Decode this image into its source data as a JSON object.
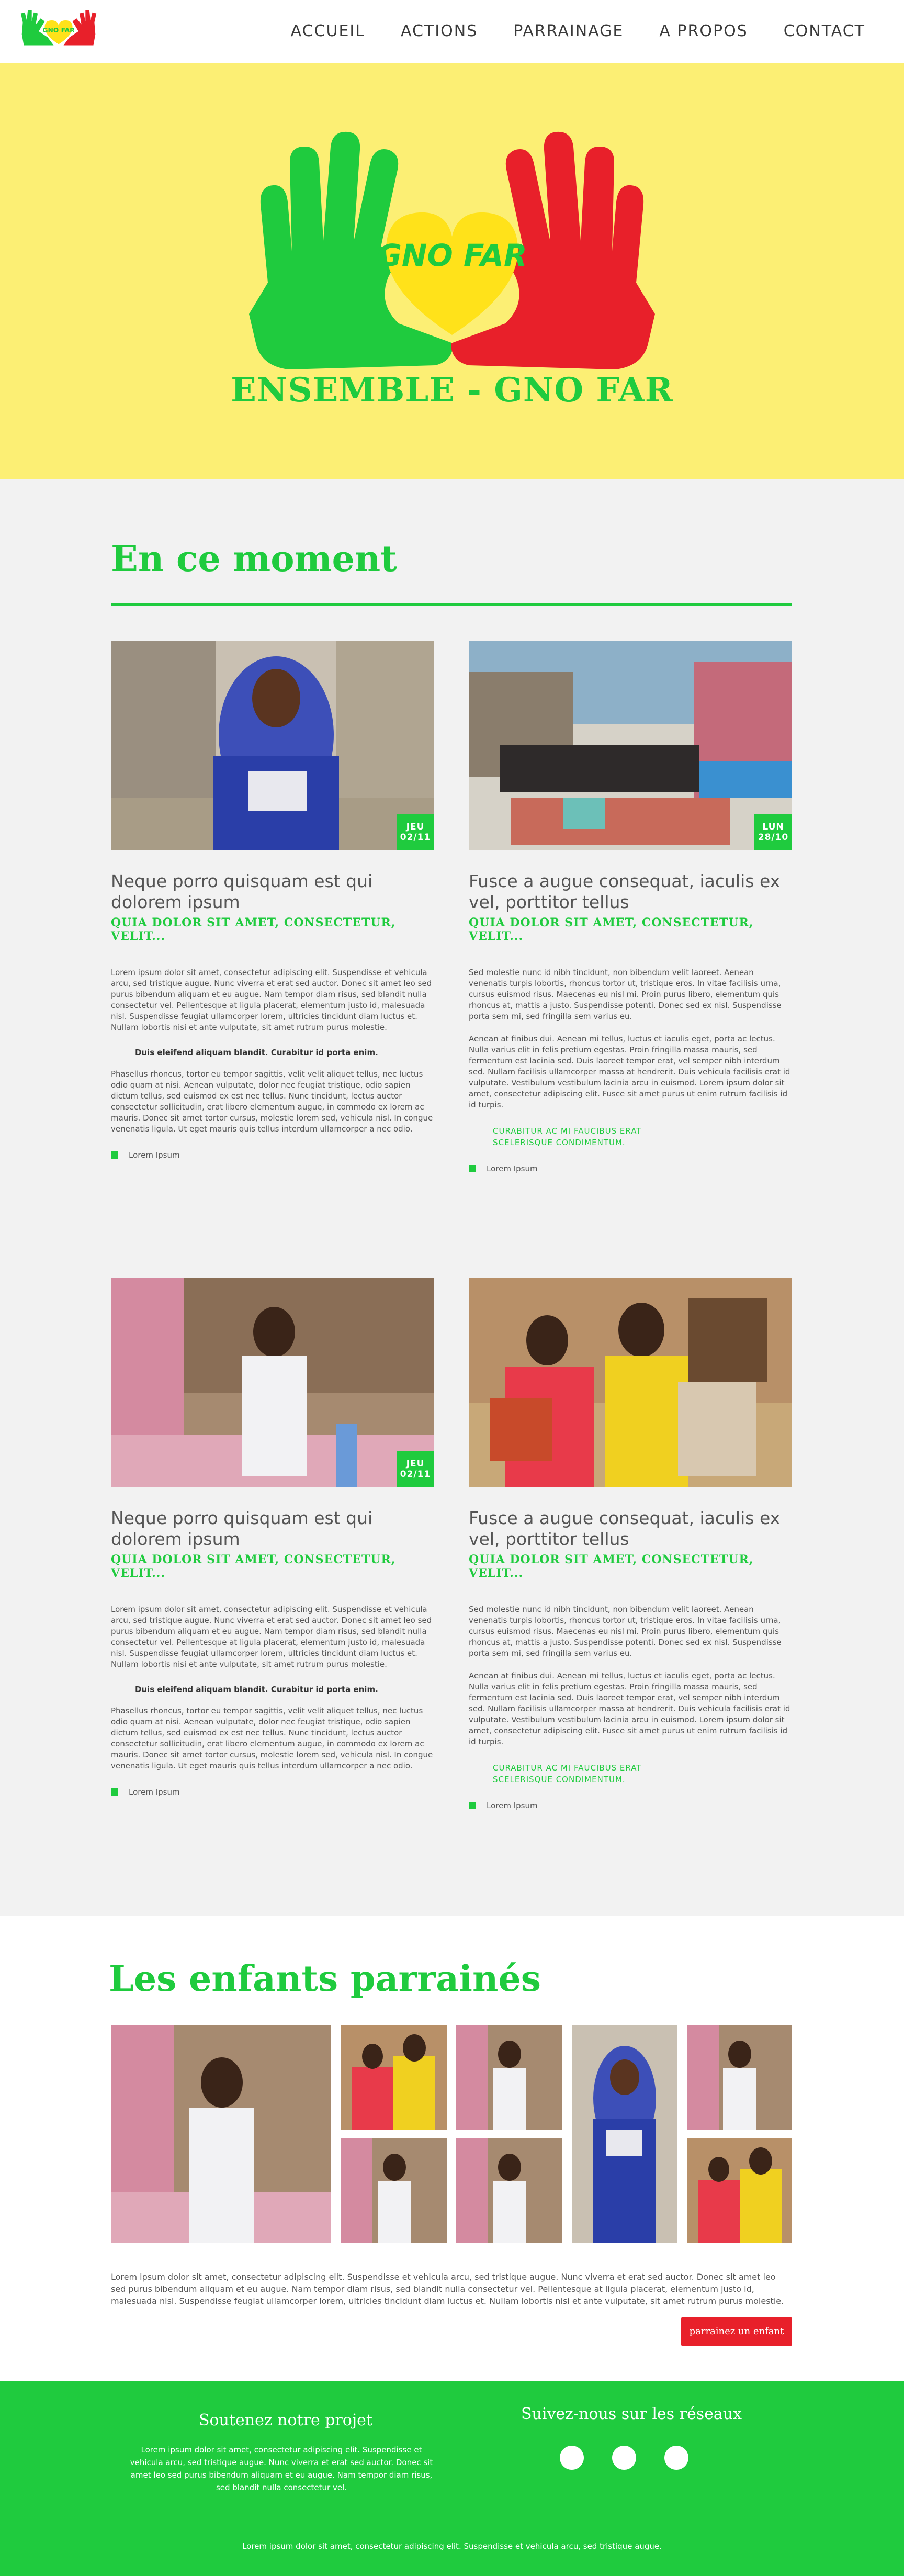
{
  "header": {
    "logo_text": "GNO FAR",
    "menu": [
      "ACCUEIL",
      "ACTIONS",
      "PARRAINAGE",
      "A PROPOS",
      "CONTACT"
    ]
  },
  "hero": {
    "logo_text": "GNO FAR",
    "title": "ENSEMBLE - GNO FAR"
  },
  "moment": {
    "title": "En ce moment",
    "cards": [
      {
        "badge_day": "JEU",
        "badge_date": "02/11",
        "title": "Neque porro quisquam est qui dolorem ipsum",
        "kicker": "QUIA DOLOR SIT AMET, CONSECTETUR, VELIT...",
        "p1": "Lorem ipsum dolor sit amet, consectetur adipiscing elit. Suspendisse et vehicula arcu, sed tristique augue. Nunc viverra et erat sed auctor. Donec sit amet leo sed purus bibendum aliquam et eu augue. Nam tempor diam risus, sed blandit nulla consectetur vel. Pellentesque at ligula placerat, elementum justo id, malesuada nisl. Suspendisse feugiat ullamcorper lorem, ultricies tincidunt diam luctus et. Nullam lobortis nisi et ante vulputate, sit amet rutrum purus molestie.",
        "quote": "Duis eleifend aliquam blandit. Curabitur id porta enim.",
        "p2": "Phasellus rhoncus, tortor eu tempor sagittis, velit velit aliquet tellus, nec luctus odio quam at nisi. Aenean vulputate, dolor nec feugiat tristique, odio sapien dictum tellus, sed euismod ex est nec tellus. Nunc tincidunt, lectus auctor consectetur sollicitudin, erat libero elementum augue, in commodo ex lorem ac mauris. Donec sit amet tortor cursus, molestie lorem sed, vehicula nisl. In congue venenatis ligula. Ut eget mauris quis tellus interdum ullamcorper a nec odio.",
        "tag": "Lorem Ipsum"
      },
      {
        "badge_day": "LUN",
        "badge_date": "28/10",
        "title": "Fusce a augue consequat, iaculis ex vel, porttitor tellus",
        "kicker": "QUIA DOLOR SIT AMET, CONSECTETUR, VELIT...",
        "p1": "Sed molestie nunc id nibh tincidunt, non bibendum velit laoreet. Aenean venenatis turpis lobortis, rhoncus tortor ut, tristique eros. In vitae facilisis urna, cursus euismod risus. Maecenas eu nisl mi. Proin purus libero, elementum quis rhoncus at, mattis a justo. Suspendisse potenti. Donec sed ex nisl. Suspendisse porta sem mi, sed fringilla sem varius eu.",
        "p2": "Aenean at finibus dui. Aenean mi tellus, luctus et iaculis eget, porta ac lectus. Nulla varius elit in felis pretium egestas. Proin fringilla massa mauris, sed fermentum est lacinia sed. Duis laoreet tempor erat, vel semper nibh interdum sed. Nullam facilisis ullamcorper massa at hendrerit. Duis vehicula facilisis erat id vulputate. Vestibulum vestibulum lacinia arcu in euismod. Lorem ipsum dolor sit amet, consectetur adipiscing elit. Fusce sit amet purus ut enim rutrum facilisis id id turpis.",
        "quote1": "CURABITUR AC MI FAUCIBUS ERAT",
        "quote2": "SCELERISQUE CONDIMENTUM.",
        "tag": "Lorem Ipsum"
      },
      {
        "badge_day": "JEU",
        "badge_date": "02/11",
        "title": "Neque porro quisquam est qui dolorem ipsum",
        "kicker": "QUIA DOLOR SIT AMET, CONSECTETUR, VELIT...",
        "p1": "Lorem ipsum dolor sit amet, consectetur adipiscing elit. Suspendisse et vehicula arcu, sed tristique augue. Nunc viverra et erat sed auctor. Donec sit amet leo sed purus bibendum aliquam et eu augue. Nam tempor diam risus, sed blandit nulla consectetur vel. Pellentesque at ligula placerat, elementum justo id, malesuada nisl. Suspendisse feugiat ullamcorper lorem, ultricies tincidunt diam luctus et. Nullam lobortis nisi et ante vulputate, sit amet rutrum purus molestie.",
        "quote": "Duis eleifend aliquam blandit. Curabitur id porta enim.",
        "p2": "Phasellus rhoncus, tortor eu tempor sagittis, velit velit aliquet tellus, nec luctus odio quam at nisi. Aenean vulputate, dolor nec feugiat tristique, odio sapien dictum tellus, sed euismod ex est nec tellus. Nunc tincidunt, lectus auctor consectetur sollicitudin, erat libero elementum augue, in commodo ex lorem ac mauris. Donec sit amet tortor cursus, molestie lorem sed, vehicula nisl. In congue venenatis ligula. Ut eget mauris quis tellus interdum ullamcorper a nec odio.",
        "tag": "Lorem Ipsum"
      },
      {
        "title": "Fusce a augue consequat, iaculis ex vel, porttitor tellus",
        "kicker": "QUIA DOLOR SIT AMET, CONSECTETUR, VELIT...",
        "p1": "Sed molestie nunc id nibh tincidunt, non bibendum velit laoreet. Aenean venenatis turpis lobortis, rhoncus tortor ut, tristique eros. In vitae facilisis urna, cursus euismod risus. Maecenas eu nisl mi. Proin purus libero, elementum quis rhoncus at, mattis a justo. Suspendisse potenti. Donec sed ex nisl. Suspendisse porta sem mi, sed fringilla sem varius eu.",
        "p2": "Aenean at finibus dui. Aenean mi tellus, luctus et iaculis eget, porta ac lectus. Nulla varius elit in felis pretium egestas. Proin fringilla massa mauris, sed fermentum est lacinia sed. Duis laoreet tempor erat, vel semper nibh interdum sed. Nullam facilisis ullamcorper massa at hendrerit. Duis vehicula facilisis erat id vulputate. Vestibulum vestibulum lacinia arcu in euismod. Lorem ipsum dolor sit amet, consectetur adipiscing elit. Fusce sit amet purus ut enim rutrum facilisis id id turpis.",
        "quote1": "CURABITUR AC MI FAUCIBUS ERAT",
        "quote2": "SCELERISQUE CONDIMENTUM.",
        "tag": "Lorem Ipsum"
      }
    ]
  },
  "children": {
    "title": "Les enfants parrainés",
    "text": "Lorem ipsum dolor sit amet, consectetur adipiscing elit. Suspendisse et vehicula arcu, sed tristique augue. Nunc viverra et erat sed auctor. Donec sit amet leo sed purus bibendum aliquam et eu augue. Nam tempor diam risus, sed blandit nulla consectetur vel. Pellentesque at ligula placerat, elementum justo id, malesuada nisl. Suspendisse feugiat ullamcorper lorem, ultricies tincidunt diam luctus et. Nullam lobortis nisi et ante vulputate, sit amet rutrum purus molestie.",
    "cta": "parrainez un enfant"
  },
  "footer": {
    "support_title": "Soutenez notre projet",
    "support_text": "Lorem ipsum dolor sit amet, consectetur adipiscing elit. Suspendisse et vehicula arcu, sed tristique augue. Nunc viverra et erat sed auctor. Donec sit amet leo sed purus bibendum aliquam et eu augue. Nam tempor diam risus, sed blandit nulla consectetur vel.",
    "social_title": "Suivez-nous sur les réseaux",
    "bottom_text": "Lorem ipsum dolor sit amet, consectetur adipiscing elit. Suspendisse et vehicula arcu, sed tristique augue."
  },
  "colors": {
    "brand_green": "#1fcb3e",
    "hero_yellow": "#fcef74",
    "heart_yellow": "#ffe21a",
    "heart_red": "#e8202a",
    "section_gray": "#f2f2f2"
  }
}
